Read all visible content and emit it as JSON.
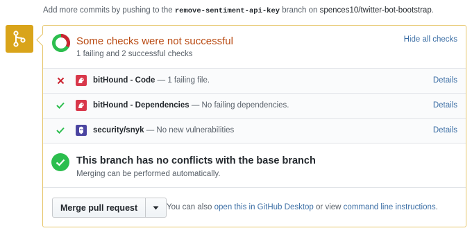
{
  "top_note": {
    "prefix": "Add more commits by pushing to the ",
    "branch": "remove-sentiment-api-key",
    "middle": " branch on ",
    "repo": "spences10/twitter-bot-bootstrap",
    "suffix": "."
  },
  "badge": {
    "icon": "git-merge-icon",
    "color": "#d9a41a"
  },
  "summary": {
    "title": "Some checks were not successful",
    "subtitle": "1 failing and 2 successful checks",
    "hide_label": "Hide all checks",
    "failing": 1,
    "successful": 2
  },
  "checks": [
    {
      "status": "failure",
      "name": "bitHound - Code",
      "description": " — 1 failing file.",
      "details_label": "Details",
      "icon": "bithound-icon"
    },
    {
      "status": "success",
      "name": "bitHound - Dependencies",
      "description": " — No failing dependencies.",
      "details_label": "Details",
      "icon": "bithound-icon"
    },
    {
      "status": "success",
      "name": "security/snyk",
      "description": " — No new vulnerabilities",
      "details_label": "Details",
      "icon": "snyk-icon"
    }
  ],
  "conflict": {
    "title": "This branch has no conflicts with the base branch",
    "subtitle": "Merging can be performed automatically."
  },
  "merge": {
    "button_label": "Merge pull request",
    "note_prefix": "You can also ",
    "desktop_link": "open this in GitHub Desktop",
    "note_middle": " or view ",
    "cli_link": "command line instructions",
    "note_suffix": "."
  },
  "colors": {
    "failure": "#cb2431",
    "success": "#2cbe4e",
    "warning_title": "#b94a12",
    "link": "#3b6ea5"
  }
}
